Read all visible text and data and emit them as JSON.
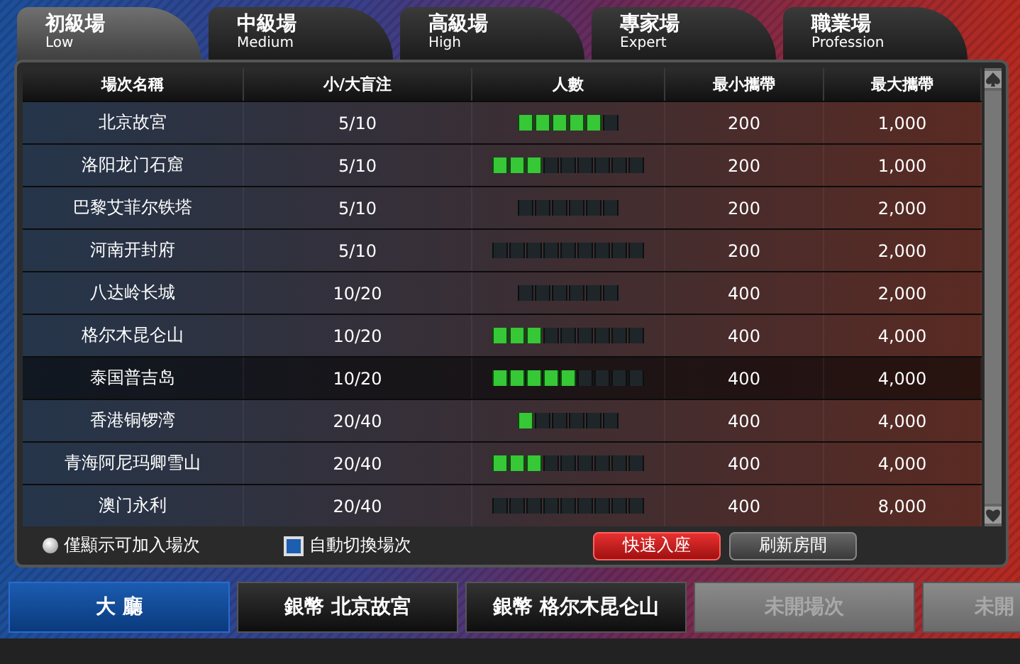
{
  "tabs": [
    {
      "title": "初級場",
      "subtitle": "Low",
      "selected": true
    },
    {
      "title": "中級場",
      "subtitle": "Medium",
      "selected": false
    },
    {
      "title": "高級場",
      "subtitle": "High",
      "selected": false
    },
    {
      "title": "專家場",
      "subtitle": "Expert",
      "selected": false
    },
    {
      "title": "職業場",
      "subtitle": "Profession",
      "selected": false
    }
  ],
  "table": {
    "columns": [
      "場次名稱",
      "小/大盲注",
      "人數",
      "最小攜帶",
      "最大攜帶"
    ],
    "rows": [
      {
        "name": "北京故宮",
        "blinds": "5/10",
        "kind": "six",
        "level": 0.833,
        "min": "200",
        "max": "1,000",
        "selected": false
      },
      {
        "name": "洛阳龙门石窟",
        "blinds": "5/10",
        "kind": "nine",
        "level": 0.333,
        "min": "200",
        "max": "1,000",
        "selected": false
      },
      {
        "name": "巴黎艾菲尔铁塔",
        "blinds": "5/10",
        "kind": "six",
        "level": 0,
        "min": "200",
        "max": "2,000",
        "selected": false
      },
      {
        "name": "河南开封府",
        "blinds": "5/10",
        "kind": "nine",
        "level": 0,
        "min": "200",
        "max": "2,000",
        "selected": false
      },
      {
        "name": "八达岭长城",
        "blinds": "10/20",
        "kind": "six",
        "level": 0,
        "min": "400",
        "max": "2,000",
        "selected": false
      },
      {
        "name": "格尔木昆仑山",
        "blinds": "10/20",
        "kind": "nine",
        "level": 0.333,
        "min": "400",
        "max": "4,000",
        "selected": false
      },
      {
        "name": "泰国普吉岛",
        "blinds": "10/20",
        "kind": "nine",
        "level": 0.556,
        "min": "400",
        "max": "4,000",
        "selected": true
      },
      {
        "name": "香港铜锣湾",
        "blinds": "20/40",
        "kind": "six",
        "level": 0.167,
        "min": "400",
        "max": "4,000",
        "selected": false
      },
      {
        "name": "青海阿尼玛卿雪山",
        "blinds": "20/40",
        "kind": "nine",
        "level": 0.333,
        "min": "400",
        "max": "4,000",
        "selected": false
      },
      {
        "name": "澳门永利",
        "blinds": "20/40",
        "kind": "nine",
        "level": 0,
        "min": "400",
        "max": "8,000",
        "selected": false
      }
    ]
  },
  "options": [
    {
      "kind": "radio",
      "label": "僅顯示可加入場次",
      "checked": false
    },
    {
      "kind": "checkbox",
      "label": "自動切換場次",
      "checked": true
    }
  ],
  "buttons": [
    {
      "label": "快速入座",
      "kind": "primary"
    },
    {
      "label": "刷新房間",
      "kind": "secondary"
    }
  ],
  "room_tabs": [
    {
      "label": "大 廳",
      "selected": true,
      "disabled": false
    },
    {
      "label": "銀幣 北京故宮",
      "selected": false,
      "disabled": false
    },
    {
      "label": "銀幣 格尔木昆仑山",
      "selected": false,
      "disabled": false
    },
    {
      "label": "未開場次",
      "selected": false,
      "disabled": true
    },
    {
      "label": "未開",
      "selected": false,
      "disabled": true
    }
  ]
}
